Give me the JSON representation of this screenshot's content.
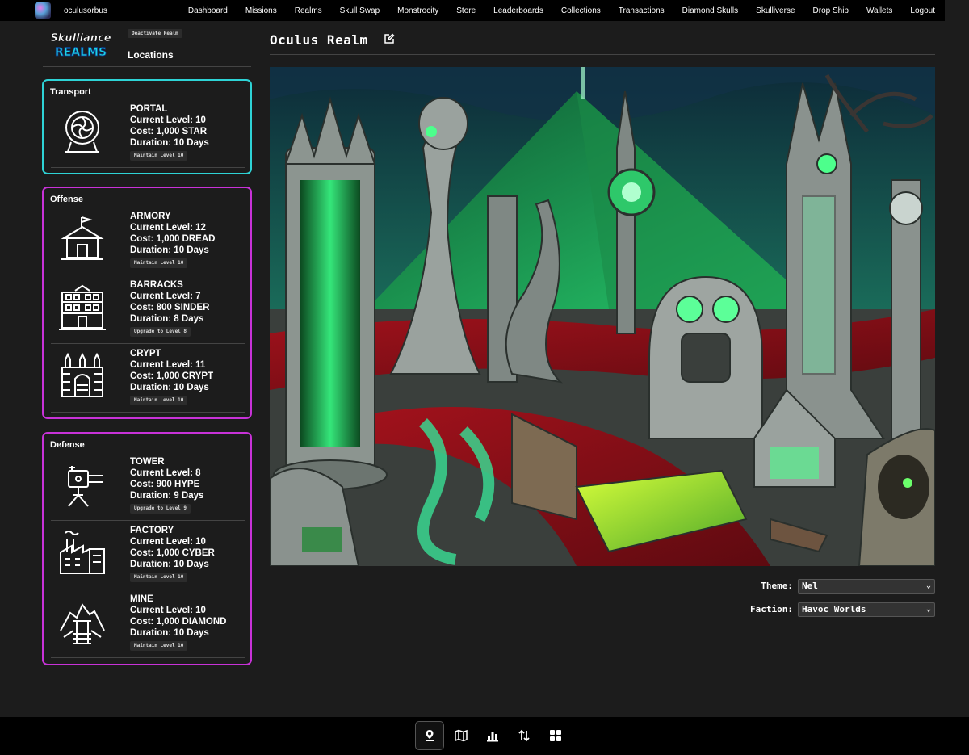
{
  "user": {
    "name": "oculusorbus"
  },
  "nav": [
    "Dashboard",
    "Missions",
    "Realms",
    "Skull Swap",
    "Monstrocity",
    "Store",
    "Leaderboards",
    "Collections",
    "Transactions",
    "Diamond Skulls",
    "Skulliverse",
    "Drop Ship",
    "Wallets",
    "Logout"
  ],
  "brand": {
    "line1": "Skulliance",
    "line2": "REALMS"
  },
  "sidebar": {
    "deactivate_label": "Deactivate Realm",
    "title": "Locations",
    "groups": [
      {
        "title": "Transport",
        "items": [
          {
            "name": "PORTAL",
            "level": "Current Level: 10",
            "cost": "Cost: 1,000 STAR",
            "duration": "Duration: 10 Days",
            "action": "Maintain Level 10",
            "icon": "portal-icon"
          }
        ]
      },
      {
        "title": "Offense",
        "items": [
          {
            "name": "ARMORY",
            "level": "Current Level: 12",
            "cost": "Cost: 1,000 DREAD",
            "duration": "Duration: 10 Days",
            "action": "Maintain Level 10",
            "icon": "armory-icon"
          },
          {
            "name": "BARRACKS",
            "level": "Current Level: 7",
            "cost": "Cost: 800 SINDER",
            "duration": "Duration: 8 Days",
            "action": "Upgrade to Level 8",
            "icon": "barracks-icon"
          },
          {
            "name": "CRYPT",
            "level": "Current Level: 11",
            "cost": "Cost: 1,000 CRYPT",
            "duration": "Duration: 10 Days",
            "action": "Maintain Level 10",
            "icon": "crypt-icon"
          }
        ]
      },
      {
        "title": "Defense",
        "items": [
          {
            "name": "TOWER",
            "level": "Current Level: 8",
            "cost": "Cost: 900 HYPE",
            "duration": "Duration: 9 Days",
            "action": "Upgrade to Level 9",
            "icon": "tower-icon"
          },
          {
            "name": "FACTORY",
            "level": "Current Level: 10",
            "cost": "Cost: 1,000 CYBER",
            "duration": "Duration: 10 Days",
            "action": "Maintain Level 10",
            "icon": "factory-icon"
          },
          {
            "name": "MINE",
            "level": "Current Level: 10",
            "cost": "Cost: 1,000 DIAMOND",
            "duration": "Duration: 10 Days",
            "action": "Maintain Level 10",
            "icon": "mine-icon"
          }
        ]
      }
    ]
  },
  "main": {
    "title": "Oculus Realm",
    "theme_label": "Theme:",
    "theme_value": "Nel",
    "faction_label": "Faction:",
    "faction_value": "Havoc Worlds"
  },
  "bottom_nav": [
    "location-pin-icon",
    "map-icon",
    "bar-chart-icon",
    "swap-arrows-icon",
    "grid-icon"
  ],
  "colors": {
    "transport_border": "#2ed3d6",
    "group_border": "#c832d8",
    "background": "#1c1c1c"
  }
}
